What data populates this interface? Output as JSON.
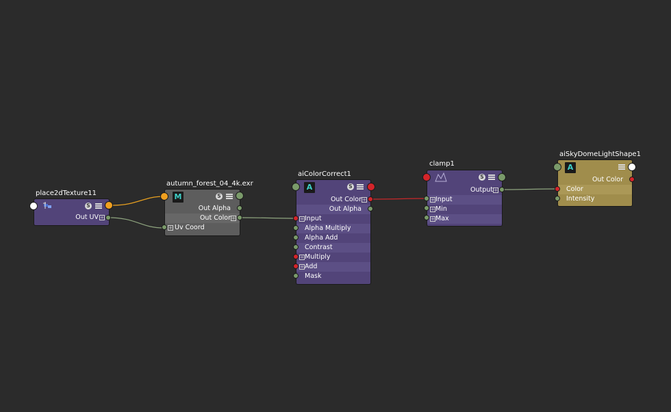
{
  "nodes": {
    "place2d": {
      "title": "place2dTexture11",
      "icon": "place2d-texture-icon",
      "outputs": [
        "Out UV"
      ]
    },
    "file": {
      "title": "autumn_forest_04_4k.exr",
      "icon": "maya-m-icon",
      "icon_letter": "M",
      "outputs": [
        "Out Alpha",
        "Out Color"
      ],
      "inputs": [
        "Uv Coord"
      ]
    },
    "colorcorrect": {
      "title": "aiColorCorrect1",
      "icon": "arnold-icon",
      "icon_letter": "A",
      "outputs": [
        "Out Color",
        "Out Alpha"
      ],
      "inputs": [
        "Input",
        "Alpha Multiply",
        "Alpha Add",
        "Contrast",
        "Multiply",
        "Add",
        "Mask"
      ]
    },
    "clamp": {
      "title": "clamp1",
      "icon": "clamp-icon",
      "outputs": [
        "Output"
      ],
      "inputs": [
        "Input",
        "Min",
        "Max"
      ]
    },
    "skydome": {
      "title": "aiSkyDomeLightShape1",
      "icon": "arnold-icon",
      "icon_letter": "A",
      "outputs": [
        "Out Color"
      ],
      "inputs": [
        "Color",
        "Intensity"
      ]
    }
  },
  "swatch_button_letter": "S",
  "colors": {
    "background": "#2b2b2b",
    "node_purple": "#524479",
    "node_gray": "#5d5d5d",
    "node_gold": "#a08d4c",
    "port_green": "#7a9a6a",
    "port_red": "#d4242a",
    "port_orange": "#f0a020",
    "wire_orange": "#e8a020",
    "wire_green": "#8fa57f",
    "wire_red": "#c8282a",
    "arnold_teal": "#3fd0c8"
  }
}
